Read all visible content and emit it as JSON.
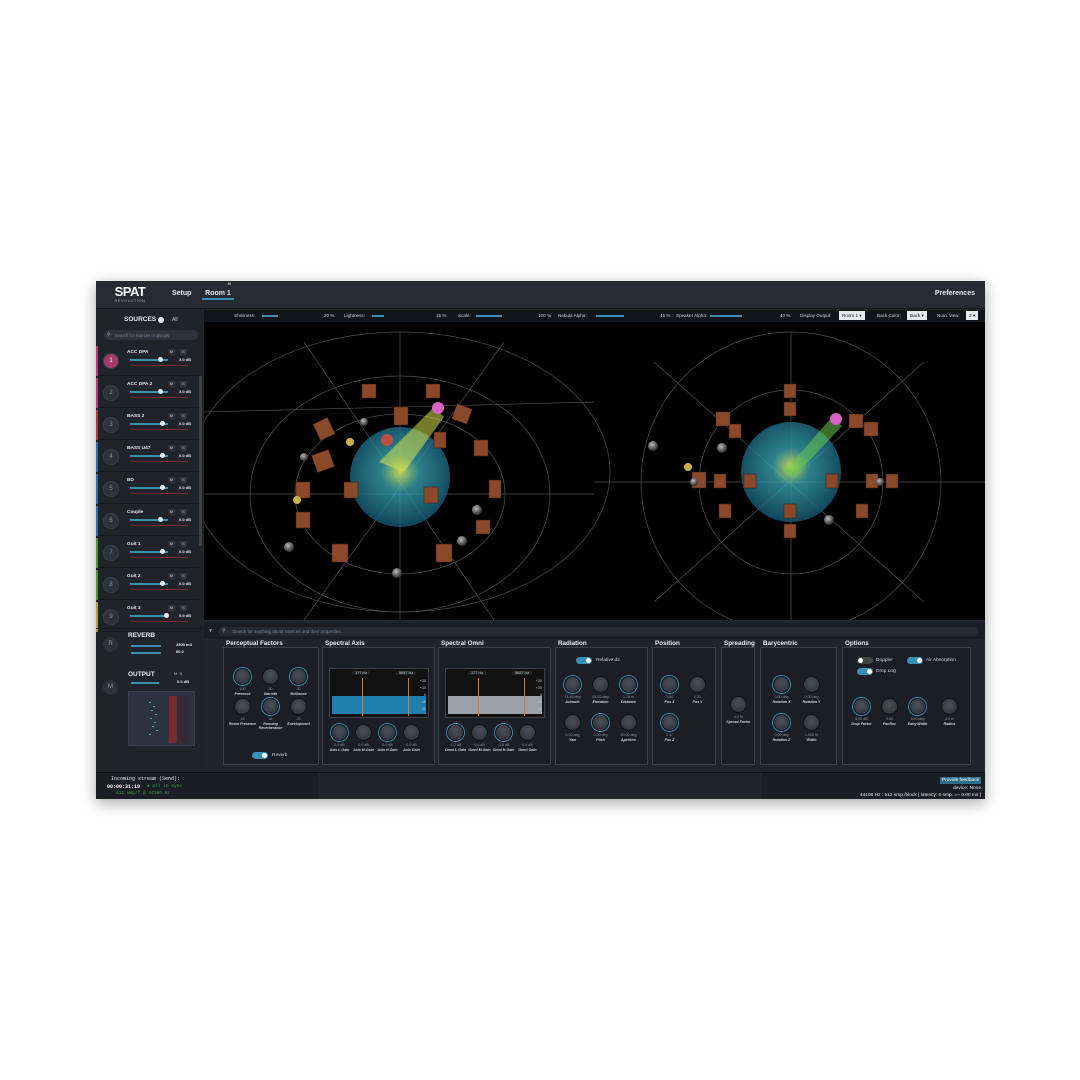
{
  "header": {
    "logo_text": "SPAT",
    "logo_sub": "REVOLUTION",
    "tabs": [
      {
        "label": "Setup"
      },
      {
        "label": "Room 1",
        "marker": "M"
      }
    ],
    "preferences_label": "Preferences"
  },
  "sources_panel": {
    "title": "SOURCES",
    "all_label": "All",
    "search_placeholder": "Search for sources or groups",
    "sources": [
      {
        "num": "1",
        "name": "ACC DPA",
        "gain": "3.0 dB",
        "m": "M",
        "s": "S",
        "color": "#c2357a"
      },
      {
        "num": "2",
        "name": "ACC DPA 2",
        "gain": "3.0 dB",
        "m": "M",
        "s": "S",
        "color": "#c2357a"
      },
      {
        "num": "3",
        "name": "BASS 2",
        "gain": "0.0 dB",
        "m": "M",
        "s": "S",
        "color": "#b33a3a"
      },
      {
        "num": "4",
        "name": "BASS U47",
        "gain": "0.0 dB",
        "m": "M",
        "s": "S",
        "color": "#2d6fae"
      },
      {
        "num": "5",
        "name": "BD",
        "gain": "0.0 dB",
        "m": "M",
        "s": "S",
        "color": "#2d6fae"
      },
      {
        "num": "6",
        "name": "Couple",
        "gain": "0.0 dB",
        "m": "M",
        "s": "S",
        "color": "#2d6fae"
      },
      {
        "num": "7",
        "name": "Guit 1",
        "gain": "0.0 dB",
        "m": "M",
        "s": "S",
        "color": "#4a9a3a"
      },
      {
        "num": "8",
        "name": "Guit 2",
        "gain": "0.0 dB",
        "m": "M",
        "s": "S",
        "color": "#4a9a3a"
      },
      {
        "num": "9",
        "name": "Guit 3",
        "gain": "5.9 dB",
        "m": "M",
        "s": "S",
        "color": "#b5a13a"
      }
    ],
    "reverb": {
      "label": "REVERB",
      "badge": "R",
      "value1": "2500 m3",
      "value2": "60.0"
    },
    "output": {
      "label": "OUTPUT",
      "badge": "M",
      "m": "M",
      "s": "S",
      "gain": "0.0 dB"
    }
  },
  "viewport_toolbar": {
    "shininess_label": "Shininess:",
    "shininess_value": "20 %",
    "lightness_label": "Lightness:",
    "lightness_value": "15 %",
    "scale_label": "Scale:",
    "scale_value": "100 %",
    "nebula_label": "Nebula Alpha:",
    "nebula_value": "45 %",
    "speaker_label": "Speaker Alpha:",
    "speaker_value": "40 %",
    "display_output_label": "Display Output:",
    "display_output_value": "Room 1",
    "back_color_label": "Back Color:",
    "back_color_value": "Back",
    "num_view_label": "Num. view:",
    "num_view_value": "2"
  },
  "property_search_placeholder": "Search for anything about sources and their properties...",
  "panels": {
    "perceptual": {
      "title": "Perceptual Factors",
      "knobs": [
        {
          "value": "100",
          "label": "Presence"
        },
        {
          "value": "30",
          "label": "Warmth"
        },
        {
          "value": "30",
          "label": "Brilliance"
        },
        {
          "value": "46",
          "label": "Room Presence"
        },
        {
          "value": "34",
          "label": "Running Reverberance"
        },
        {
          "value": "25",
          "label": "Envelopment"
        }
      ],
      "reverb_toggle_label": "Reverb"
    },
    "spectral_axis": {
      "title": "Spectral Axis",
      "freq_low": "177 Hz",
      "freq_high": "5657 Hz",
      "gains_right": [
        "+20",
        "+10",
        "0",
        "-10",
        "-20"
      ],
      "knobs": [
        {
          "value": "0.0 dB",
          "label": "Axis L.Gain"
        },
        {
          "value": "0.0 dB",
          "label": "Axis M.Gain"
        },
        {
          "value": "0.0 dB",
          "label": "Axis H.Gain"
        },
        {
          "value": "0.0 dB",
          "label": "Axis Gain"
        }
      ]
    },
    "spectral_omni": {
      "title": "Spectral Omni",
      "freq_low": "177 Hz",
      "freq_high": "5657 Hz",
      "gains_right": [
        "+20",
        "+10",
        "0",
        "-10",
        "-20"
      ],
      "knobs": [
        {
          "value": "-1.7 dB",
          "label": "Omni L.Gain"
        },
        {
          "value": "0.0 dB",
          "label": "Omni M.Gain"
        },
        {
          "value": "-3.8 dB",
          "label": "Omni H.Gain"
        },
        {
          "value": "0.0 dB",
          "label": "Omni Gain"
        }
      ]
    },
    "radiation": {
      "title": "Radiation",
      "toggle_label": "Relative dir.",
      "knobs": [
        {
          "value": "71.46 deg",
          "label": "Azimuth"
        },
        {
          "value": "51.52 deg",
          "label": "Elevation"
        },
        {
          "value": "1.76 m",
          "label": "Distance"
        },
        {
          "value": "0.00 deg",
          "label": "Yaw"
        },
        {
          "value": "0.00 deg",
          "label": "Pitch"
        },
        {
          "value": "80.00 deg",
          "label": "Aperture"
        }
      ]
    },
    "position": {
      "title": "Position",
      "knobs": [
        {
          "value": "1.04",
          "label": "Pos X"
        },
        {
          "value": "0.31",
          "label": "Pos Y"
        },
        {
          "value": "1.37",
          "label": "Pos Z"
        }
      ]
    },
    "spreading": {
      "title": "Spreading",
      "knobs": [
        {
          "value": "0.0 %",
          "label": "Spread Factor"
        }
      ]
    },
    "barycentric": {
      "title": "Barycentric",
      "knobs": [
        {
          "value": "0.00 deg",
          "label": "Rotation X"
        },
        {
          "value": "0.00 deg",
          "label": "Rotation Y"
        },
        {
          "value": "0.00 deg",
          "label": "Rotation Z"
        },
        {
          "value": "1.000 %",
          "label": "Width"
        }
      ]
    },
    "options": {
      "title": "Options",
      "toggles": [
        {
          "label": "Doppler",
          "on": false
        },
        {
          "label": "Air Absorption",
          "on": true
        },
        {
          "label": "Drop Log",
          "on": true
        }
      ],
      "knobs": [
        {
          "value": "6.00 dB",
          "label": "Drop Factor"
        },
        {
          "value": "0.00",
          "label": "PanRev"
        },
        {
          "value": "10.0 deg",
          "label": "Early Width"
        },
        {
          "value": "1.0 m",
          "label": "Radius"
        }
      ]
    }
  },
  "status": {
    "stream_label": "Incoming stream (Send):",
    "time": "00:00:31:19",
    "sync": "all in sync",
    "rate_left": "512 smp/f @ 44100 Hz",
    "feedback": "Provide feedback",
    "device": "device: None",
    "samplerate": "44100 Hz : 512 smp./block [ latency: 0 smp. =~ 0.00 ms ]"
  },
  "colors": {
    "accent": "#3a8fb6",
    "background": "#20242c",
    "viewport": "#000000"
  }
}
